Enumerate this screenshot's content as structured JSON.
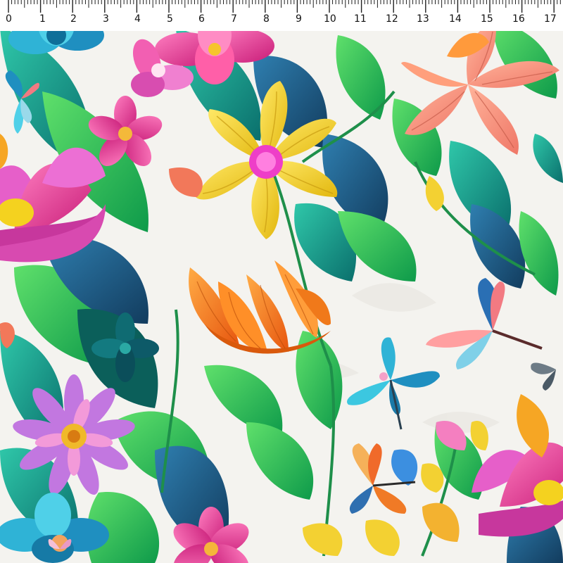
{
  "ruler": {
    "labels": [
      "0",
      "1",
      "2",
      "3",
      "4",
      "5",
      "6",
      "7",
      "8",
      "9",
      "10",
      "11",
      "12",
      "13",
      "14",
      "15",
      "16",
      "17"
    ]
  },
  "artwork": {
    "subject": "paper-cut floral pattern with butterflies",
    "palette": {
      "background": "#f4f3ef",
      "leaf_green": "#1fb86a",
      "leaf_teal": "#0f8f86",
      "leaf_navy": "#1b4f78",
      "flower_pink": "#e93f8e",
      "flower_yellow": "#f2d12a",
      "flower_orange": "#f47a1e",
      "flower_salmon": "#f29078",
      "flower_purple": "#b86ad8",
      "butterfly_blue": "#3db5d8"
    }
  }
}
